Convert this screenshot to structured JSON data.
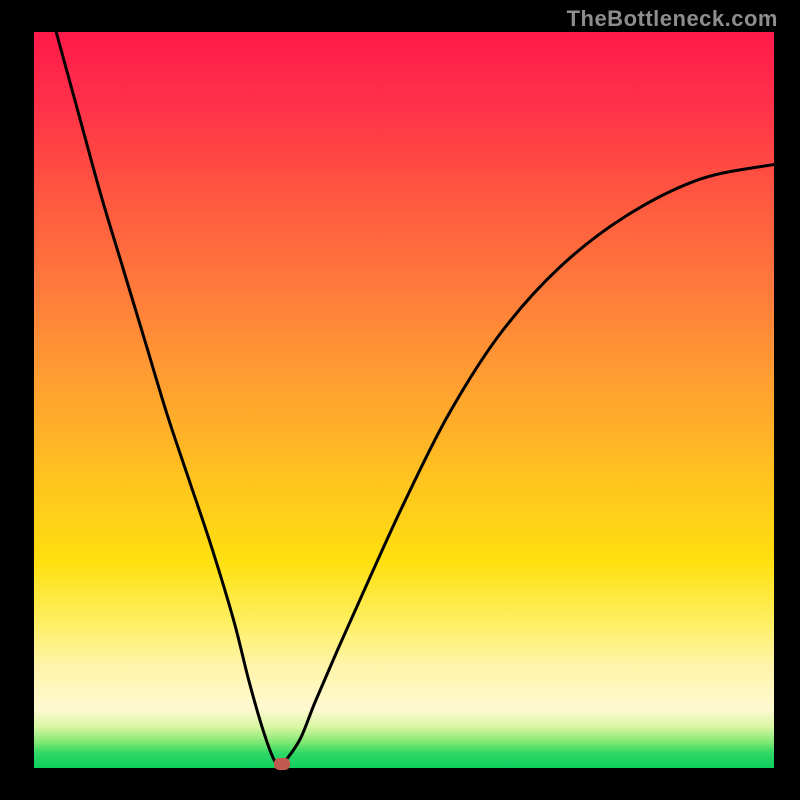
{
  "watermark": "TheBottleneck.com",
  "chart_data": {
    "type": "line",
    "title": "",
    "xlabel": "",
    "ylabel": "",
    "xlim": [
      0,
      100
    ],
    "ylim": [
      0,
      100
    ],
    "series": [
      {
        "name": "bottleneck-curve",
        "x": [
          3,
          6,
          9,
          12,
          15,
          18,
          21,
          24,
          27,
          29,
          31,
          32.5,
          33.5,
          34,
          36,
          38,
          41,
          45,
          50,
          56,
          63,
          71,
          80,
          90,
          100
        ],
        "values": [
          100,
          89,
          78,
          68,
          58,
          48,
          39,
          30,
          20,
          12,
          5,
          1,
          0.5,
          1,
          4,
          9,
          16,
          25,
          36,
          48,
          59,
          68,
          75,
          80,
          82
        ]
      }
    ],
    "minimum": {
      "x": 33.5,
      "y": 0.5
    },
    "marker_color": "#c15a4f",
    "gradient_stops": [
      {
        "pos": 0,
        "color": "#ff1a4a"
      },
      {
        "pos": 50,
        "color": "#ffa030"
      },
      {
        "pos": 80,
        "color": "#ffef60"
      },
      {
        "pos": 100,
        "color": "#0ecf5e"
      }
    ]
  }
}
